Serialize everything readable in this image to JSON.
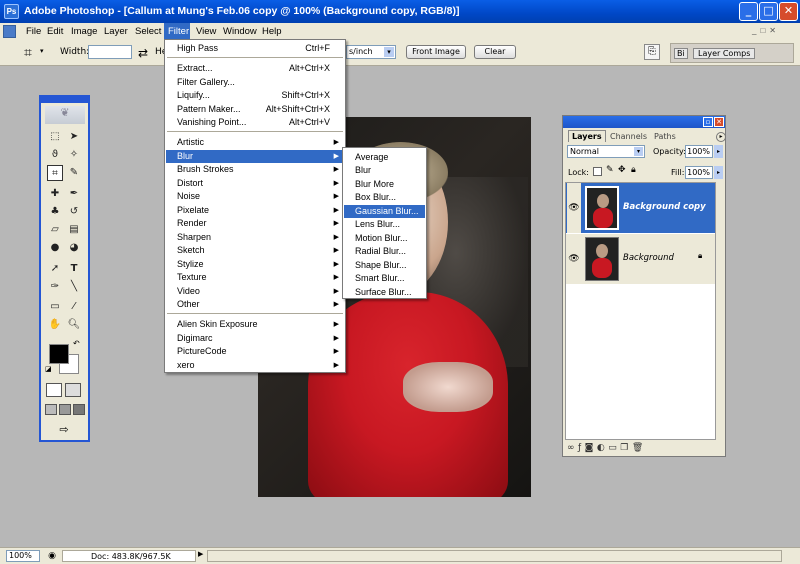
{
  "window": {
    "title": "Adobe Photoshop - [Callum at Mung's Feb.06 copy @ 100% (Background copy, RGB/8)]",
    "minimize": "_",
    "maximize": "□",
    "close": "✕",
    "app_icon": "Ps"
  },
  "menubar": [
    "File",
    "Edit",
    "Image",
    "Layer",
    "Select",
    "Filter",
    "View",
    "Window",
    "Help"
  ],
  "options": {
    "width_label": "Width:",
    "height_label": "He",
    "resolution_unit": "s/inch",
    "front_image": "Front Image",
    "clear": "Clear",
    "layer_comps_tab": "Layer Comps",
    "brushes_tab": "Bi"
  },
  "filter_menu": {
    "items": [
      {
        "label": "High Pass",
        "shortcut": "Ctrl+F"
      },
      {
        "label": "Extract...",
        "shortcut": "Alt+Ctrl+X"
      },
      {
        "label": "Filter Gallery..."
      },
      {
        "label": "Liquify...",
        "shortcut": "Shift+Ctrl+X"
      },
      {
        "label": "Pattern Maker...",
        "shortcut": "Alt+Shift+Ctrl+X"
      },
      {
        "label": "Vanishing Point...",
        "shortcut": "Alt+Ctrl+V"
      },
      {
        "label": "Artistic",
        "sub": true
      },
      {
        "label": "Blur",
        "sub": true,
        "highlight": true
      },
      {
        "label": "Brush Strokes",
        "sub": true
      },
      {
        "label": "Distort",
        "sub": true
      },
      {
        "label": "Noise",
        "sub": true
      },
      {
        "label": "Pixelate",
        "sub": true
      },
      {
        "label": "Render",
        "sub": true
      },
      {
        "label": "Sharpen",
        "sub": true
      },
      {
        "label": "Sketch",
        "sub": true
      },
      {
        "label": "Stylize",
        "sub": true
      },
      {
        "label": "Texture",
        "sub": true
      },
      {
        "label": "Video",
        "sub": true
      },
      {
        "label": "Other",
        "sub": true
      },
      {
        "label": "Alien Skin Exposure",
        "sub": true
      },
      {
        "label": "Digimarc",
        "sub": true
      },
      {
        "label": "PictureCode",
        "sub": true
      },
      {
        "label": "xero",
        "sub": true
      }
    ]
  },
  "blur_submenu": [
    "Average",
    "Blur",
    "Blur More",
    "Box Blur...",
    "Gaussian Blur...",
    "Lens Blur...",
    "Motion Blur...",
    "Radial Blur...",
    "Shape Blur...",
    "Smart Blur...",
    "Surface Blur..."
  ],
  "blur_highlight_index": 4,
  "layers_panel": {
    "tabs": [
      "Layers",
      "Channels",
      "Paths"
    ],
    "blend_mode": "Normal",
    "opacity_label": "Opacity:",
    "opacity": "100%",
    "lock_label": "Lock:",
    "fill_label": "Fill:",
    "fill": "100%",
    "layers": [
      {
        "name": "Background copy",
        "selected": true
      },
      {
        "name": "Background",
        "locked": true
      }
    ]
  },
  "status": {
    "zoom": "100%",
    "doc": "Doc: 483.8K/967.5K"
  },
  "colors": {
    "title_blue": "#0a5ee6",
    "highlight": "#316ac5",
    "workspace": "#b7b7b7",
    "sweater_red": "#c81822"
  },
  "icons": [
    "photoshop-app-icon",
    "crop-tool-icon",
    "marquee-tool-icon",
    "move-tool-icon",
    "lasso-tool-icon",
    "magic-wand-icon",
    "healing-brush-icon",
    "brush-icon",
    "clone-stamp-icon",
    "history-brush-icon",
    "eraser-icon",
    "gradient-icon",
    "blur-tool-icon",
    "dodge-icon",
    "path-selection-icon",
    "type-icon",
    "pen-icon",
    "line-icon",
    "notes-icon",
    "eyedropper-icon",
    "hand-icon",
    "zoom-icon",
    "eye-icon",
    "lock-icon"
  ]
}
